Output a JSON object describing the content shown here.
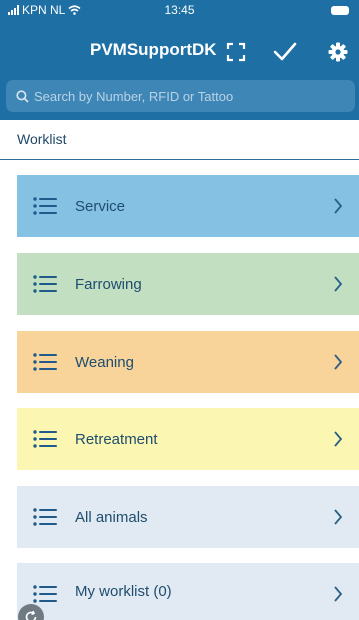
{
  "status_bar": {
    "carrier": "KPN NL",
    "time": "13:45"
  },
  "header": {
    "title": "PVMSupportDK"
  },
  "search": {
    "placeholder": "Search by Number, RFID or Tattoo"
  },
  "section": {
    "title": "Worklist"
  },
  "items": [
    {
      "label": "Service",
      "color": "#84c1e3"
    },
    {
      "label": "Farrowing",
      "color": "#c3dfc2"
    },
    {
      "label": "Weaning",
      "color": "#f8d49b"
    },
    {
      "label": "Retreatment",
      "color": "#fbf7b3"
    },
    {
      "label": "All animals",
      "color": "#e1eaf3"
    },
    {
      "label": "My worklist (0)",
      "color": "#e1eaf3"
    }
  ],
  "icons": {
    "list": "list-icon",
    "chevron": "chevron-right-icon",
    "search": "search-icon",
    "expand": "expand-icon",
    "check": "check-icon",
    "settings": "gear-icon"
  },
  "colors": {
    "brand": "#1d6fa4",
    "list_icon": "#1f5a8a",
    "text": "#1f4d6e"
  }
}
